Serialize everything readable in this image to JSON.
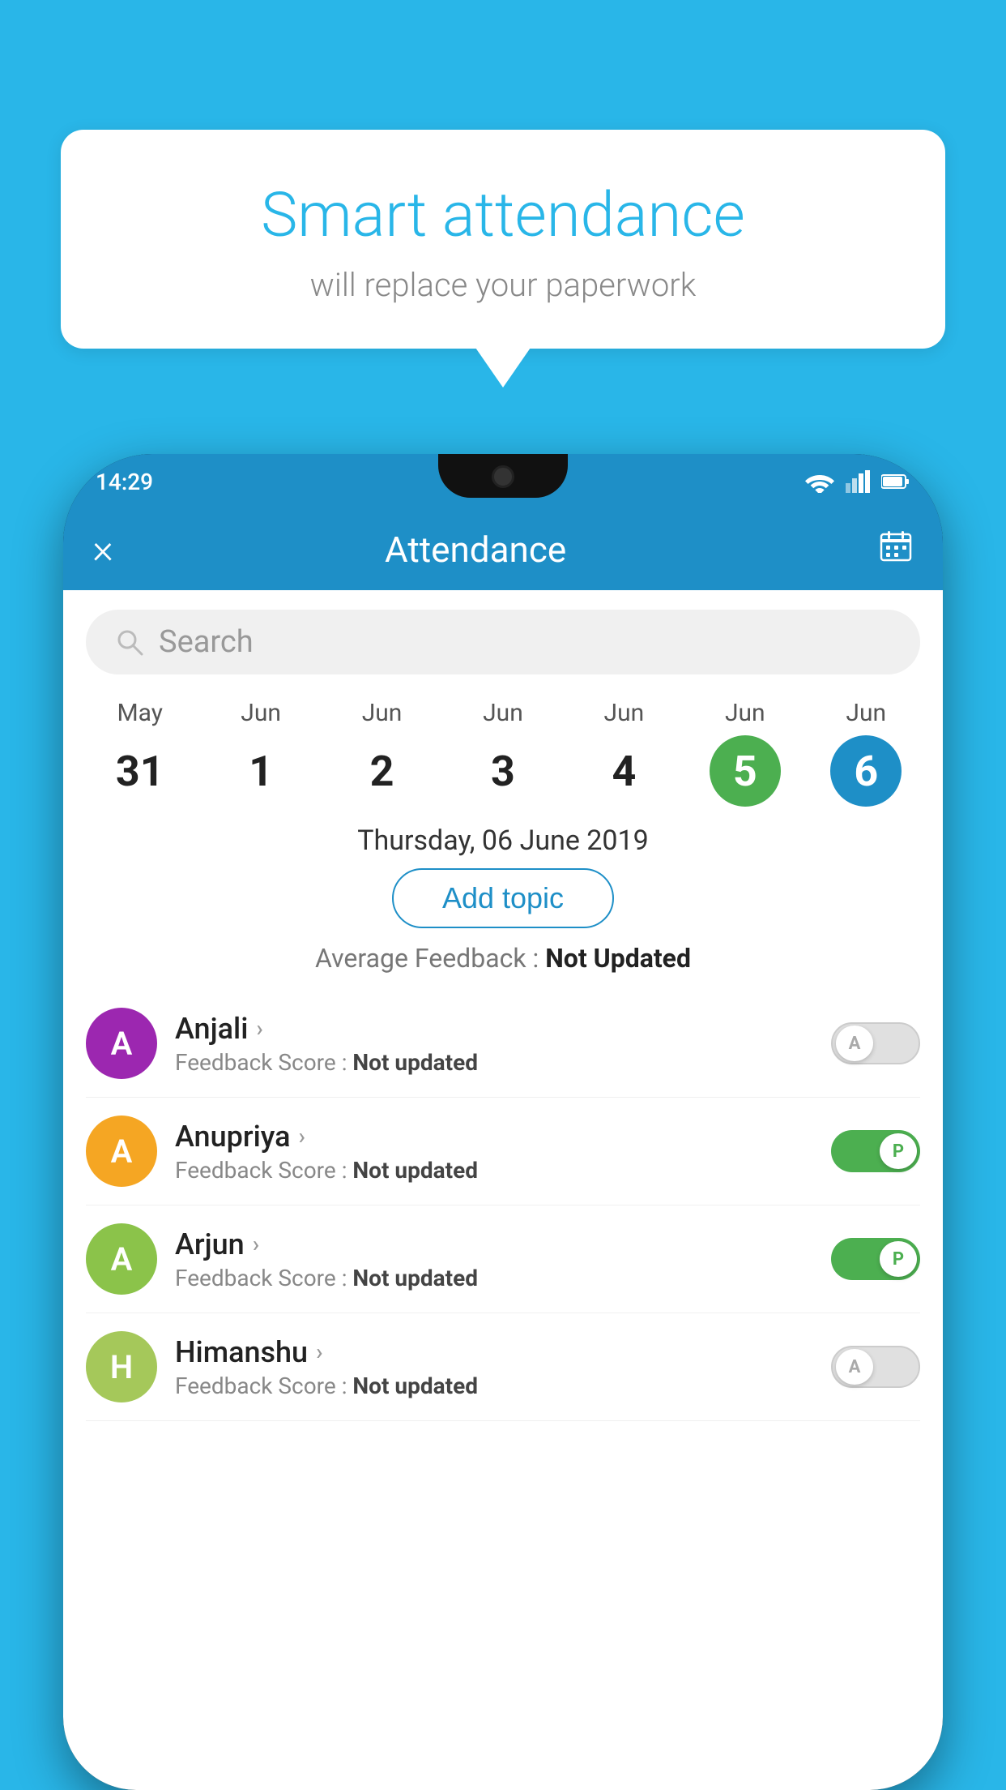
{
  "background_color": "#29b6e8",
  "bubble": {
    "title": "Smart attendance",
    "subtitle": "will replace your paperwork"
  },
  "status_bar": {
    "time": "14:29"
  },
  "app_bar": {
    "title": "Attendance",
    "close_label": "×"
  },
  "search": {
    "placeholder": "Search"
  },
  "calendar": {
    "days": [
      {
        "month": "May",
        "date": "31",
        "style": "normal"
      },
      {
        "month": "Jun",
        "date": "1",
        "style": "normal"
      },
      {
        "month": "Jun",
        "date": "2",
        "style": "normal"
      },
      {
        "month": "Jun",
        "date": "3",
        "style": "normal"
      },
      {
        "month": "Jun",
        "date": "4",
        "style": "normal"
      },
      {
        "month": "Jun",
        "date": "5",
        "style": "green"
      },
      {
        "month": "Jun",
        "date": "6",
        "style": "blue"
      }
    ]
  },
  "selected_date": "Thursday, 06 June 2019",
  "add_topic_label": "Add topic",
  "avg_feedback_label": "Average Feedback : ",
  "avg_feedback_value": "Not Updated",
  "students": [
    {
      "name": "Anjali",
      "avatar_letter": "A",
      "avatar_color": "#9c27b0",
      "feedback_label": "Feedback Score : ",
      "feedback_value": "Not updated",
      "attendance": "absent"
    },
    {
      "name": "Anupriya",
      "avatar_letter": "A",
      "avatar_color": "#f5a623",
      "feedback_label": "Feedback Score : ",
      "feedback_value": "Not updated",
      "attendance": "present"
    },
    {
      "name": "Arjun",
      "avatar_letter": "A",
      "avatar_color": "#8bc34a",
      "feedback_label": "Feedback Score : ",
      "feedback_value": "Not updated",
      "attendance": "present"
    },
    {
      "name": "Himanshu",
      "avatar_letter": "H",
      "avatar_color": "#a5c85a",
      "feedback_label": "Feedback Score : ",
      "feedback_value": "Not updated",
      "attendance": "absent"
    }
  ]
}
